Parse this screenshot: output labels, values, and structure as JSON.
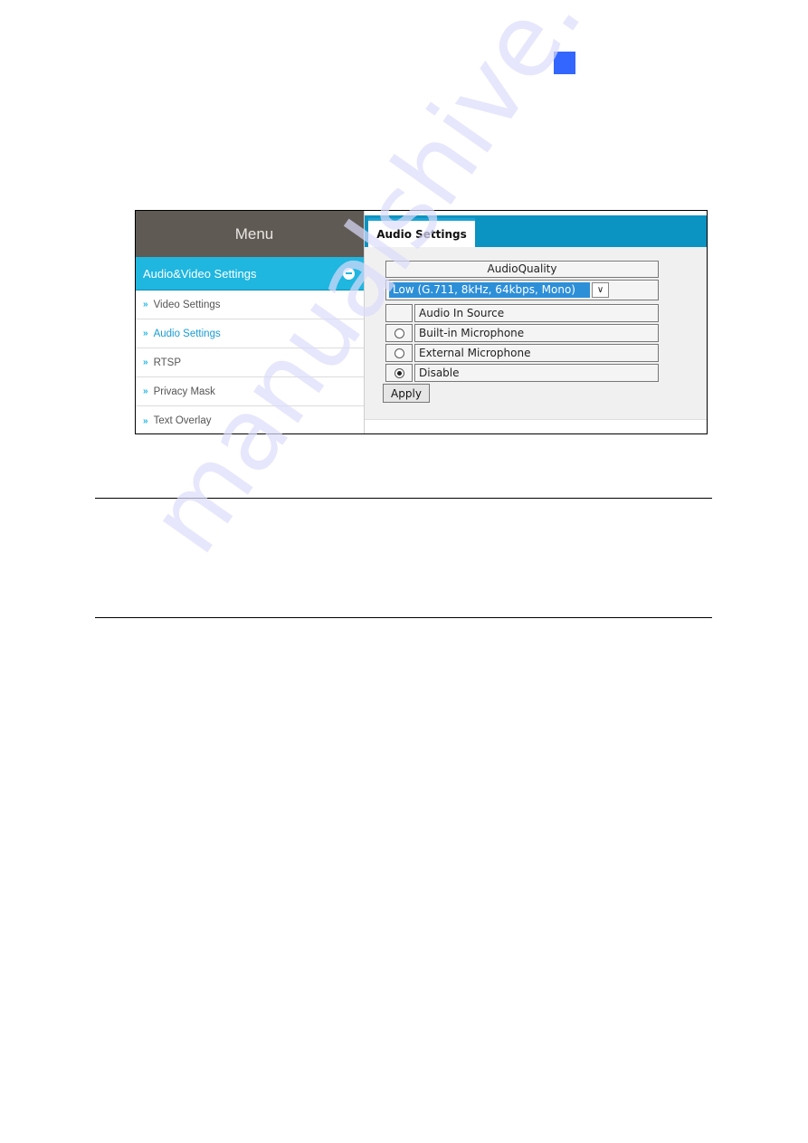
{
  "page": {
    "marker_color": "#3366ff",
    "watermark": "manualshive.com"
  },
  "sidebar": {
    "header": "Menu",
    "section": {
      "label": "Audio&Video Settings",
      "expanded": true
    },
    "items": [
      {
        "label": "Video Settings",
        "active": false
      },
      {
        "label": "Audio Settings",
        "active": true
      },
      {
        "label": "RTSP",
        "active": false
      },
      {
        "label": "Privacy Mask",
        "active": false
      },
      {
        "label": "Text Overlay",
        "active": false
      }
    ],
    "chevron_glyph": "»"
  },
  "content": {
    "tab": "Audio Settings",
    "audio_quality": {
      "label": "AudioQuality",
      "selected": "Low (G.711, 8kHz, 64kbps, Mono)",
      "arrow_glyph": "∨"
    },
    "audio_in_source": {
      "label": "Audio In Source",
      "options": [
        {
          "label": "Built-in Microphone",
          "checked": false
        },
        {
          "label": "External Microphone",
          "checked": false
        },
        {
          "label": "Disable",
          "checked": true
        }
      ]
    },
    "apply_label": "Apply"
  },
  "colors": {
    "menu_header_bg": "#5f5a54",
    "section_bg": "#1fb6e0",
    "tabbar_bg": "#0b93c2",
    "active_item": "#1a9cd0",
    "select_highlight": "#2d8fd8"
  }
}
